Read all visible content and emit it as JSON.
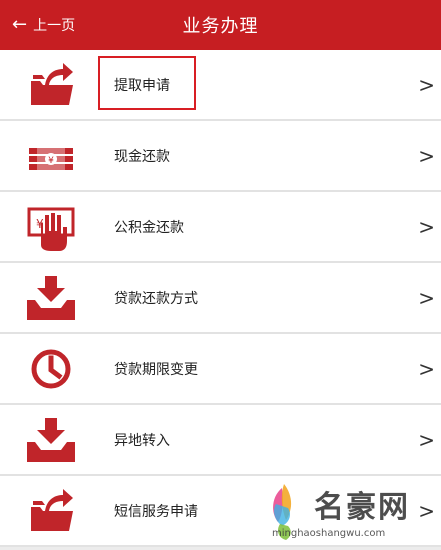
{
  "header": {
    "back_label": "上一页",
    "title": "业务办理"
  },
  "items": [
    {
      "label": "提取申请",
      "icon": "folder-arrow-icon"
    },
    {
      "label": "现金还款",
      "icon": "cash-stack-icon"
    },
    {
      "label": "公积金还款",
      "icon": "yuan-hand-icon"
    },
    {
      "label": "贷款还款方式",
      "icon": "inbox-download-icon"
    },
    {
      "label": "贷款期限变更",
      "icon": "clock-icon"
    },
    {
      "label": "异地转入",
      "icon": "inbox-download-icon"
    },
    {
      "label": "短信服务申请",
      "icon": "folder-arrow-icon"
    }
  ],
  "chevron": ">",
  "watermark": {
    "name": "名豪网",
    "url": "minghaoshangwu.com"
  },
  "colors": {
    "accent": "#c61e22",
    "icon": "#c0252a"
  }
}
